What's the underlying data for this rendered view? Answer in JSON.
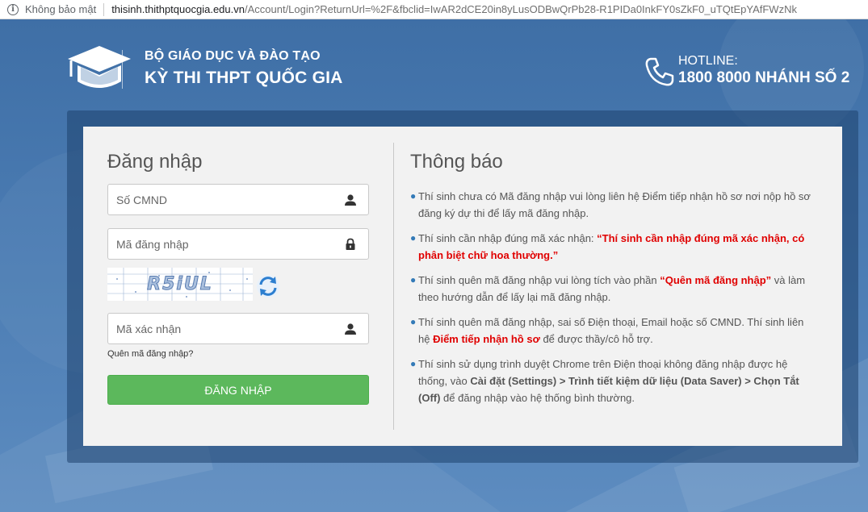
{
  "browser": {
    "security_label": "Không bảo mật",
    "url_host": "thisinh.thithptquocgia.edu.vn",
    "url_path": "/Account/Login?ReturnUrl=%2F&fbclid=IwAR2dCE20in8yLusODBwQrPb28-R1PIDa0InkFY0sZkF0_uTQtEpYAfFWzNk"
  },
  "header": {
    "org_name": "BỘ GIÁO DỤC VÀ ĐÀO TẠO",
    "exam_name": "KỲ THI THPT QUỐC GIA",
    "hotline_label": "HOTLINE:",
    "hotline_number": "1800 8000 NHÁNH SỐ 2"
  },
  "login": {
    "title": "Đăng nhập",
    "id_placeholder": "Số CMND",
    "password_placeholder": "Mã đăng nhập",
    "captcha_text": "R5iUL",
    "captcha_placeholder": "Mã xác nhận",
    "forgot_link": "Quên mã đăng nhập?",
    "submit_label": "ĐĂNG NHẬP"
  },
  "notice": {
    "title": "Thông báo",
    "item1": "Thí sinh chưa có Mã đăng nhập vui lòng liên hệ Điểm tiếp nhận hồ sơ nơi nộp hồ sơ đăng ký dự thi để lấy mã đăng nhập.",
    "item2_text": "Thí sinh cần nhập đúng mã xác nhận: ",
    "item2_highlight": "“Thí sinh cần nhập đúng mã xác nhận, có phân biệt chữ hoa thường.”",
    "item3_text_a": "Thí sinh quên mã đăng nhập vui lòng tích vào phần ",
    "item3_highlight": "“Quên mã đăng nhập”",
    "item3_text_b": " và làm theo hướng dẫn để lấy lại mã đăng nhập.",
    "item4_text_a": "Thí sinh quên mã đăng nhập, sai số Điện thoại, Email hoặc số CMND. Thí sinh liên hệ ",
    "item4_highlight": "Điểm tiếp nhận hồ sơ",
    "item4_text_b": " để được thầy/cô hỗ trợ.",
    "item5_text_a": "Thí sinh sử dụng trình duyệt Chrome trên Điện thoại không đăng nhập được hệ thống, vào ",
    "item5_strong": "Cài đặt (Settings) > Trình tiết kiệm dữ liệu (Data Saver) > Chọn Tắt (Off)",
    "item5_text_b": " để đăng nhập vào hệ thống bình thường."
  },
  "colors": {
    "accent_green": "#5cb85c",
    "highlight_red": "#e00000",
    "bullet_blue": "#337ab7",
    "header_blue": "#3f6fa6"
  }
}
